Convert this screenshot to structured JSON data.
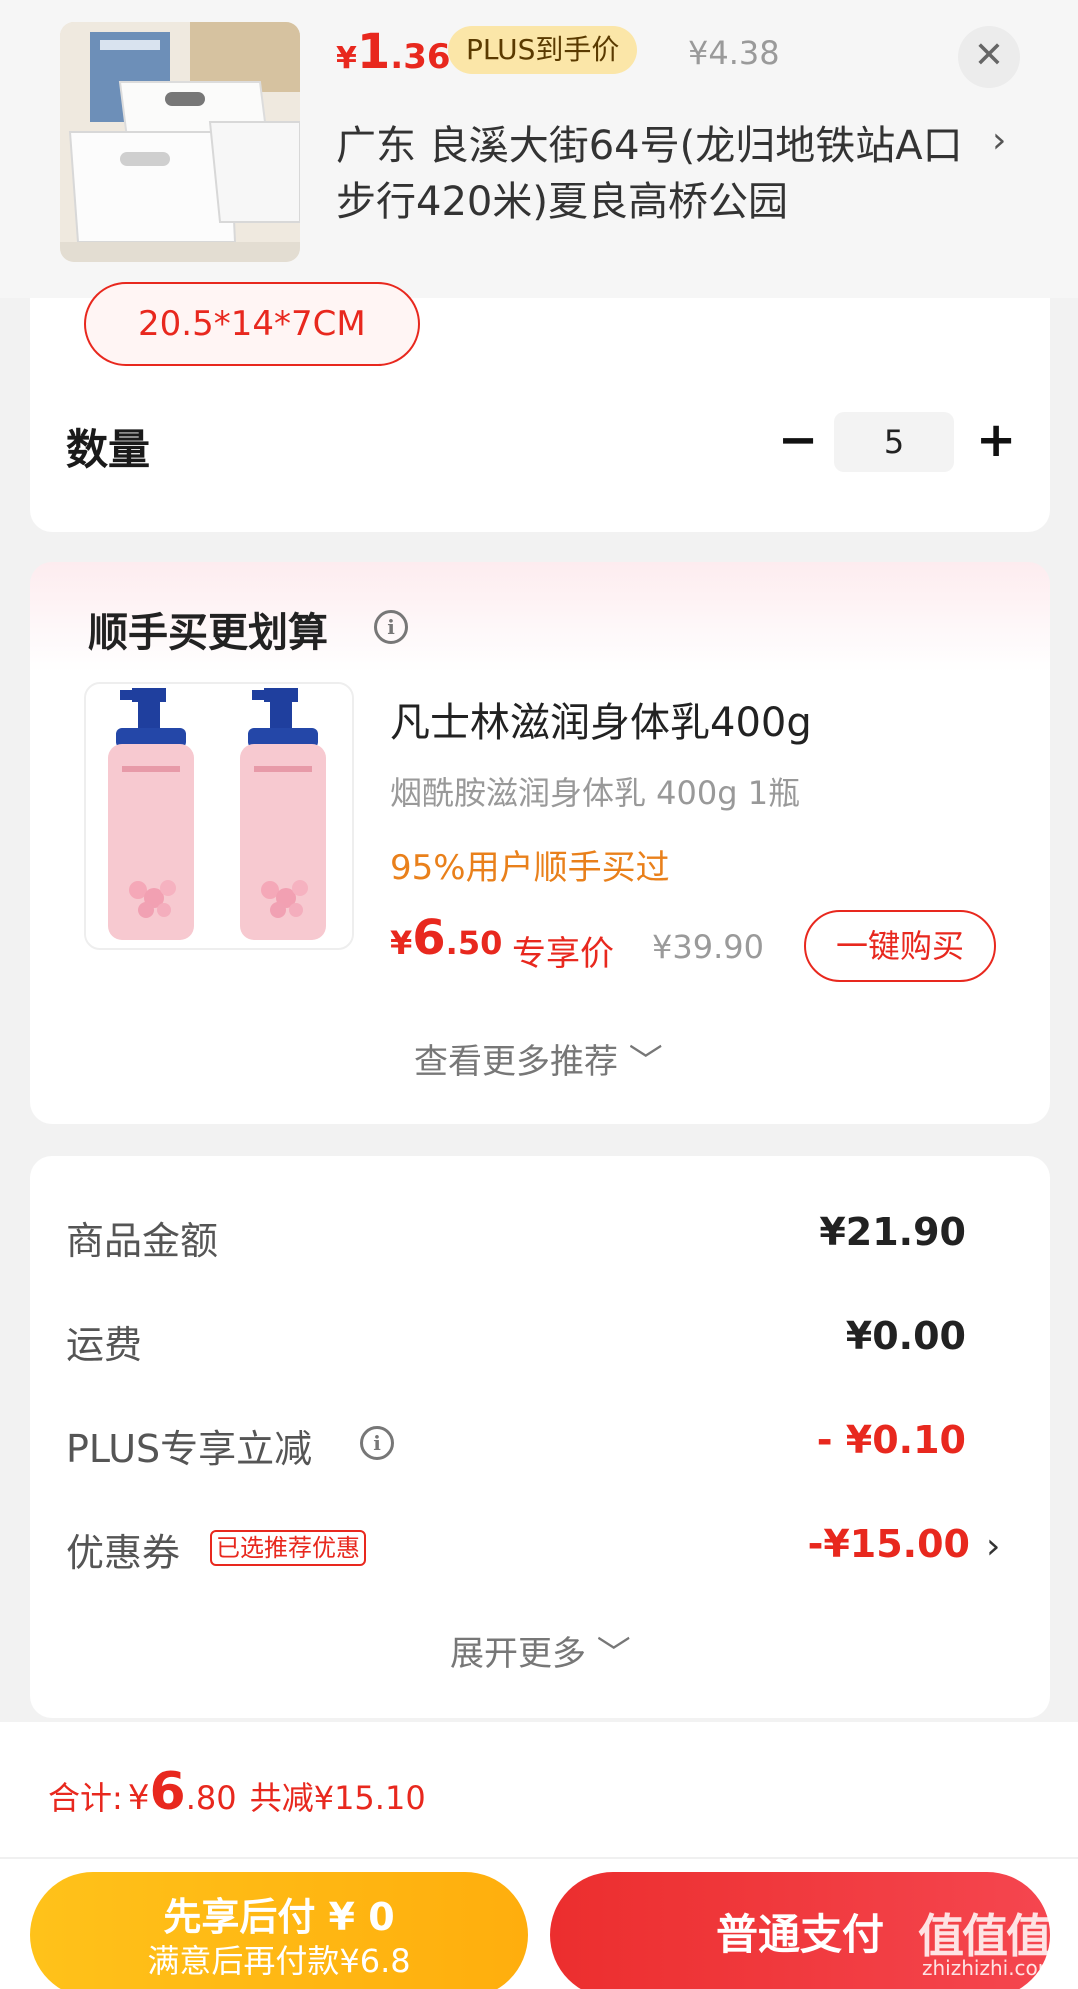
{
  "header": {
    "price_symbol": "¥",
    "price_int": "1",
    "price_dec": ".36",
    "plus_badge": "PLUS到手价",
    "original_price": "¥4.38",
    "close_icon": "close-icon",
    "address": "广东  良溪大街64号(龙归地铁站A口步行420米)夏良高桥公园",
    "address_chevron": "›"
  },
  "spec": {
    "selected_size": "20.5*14*7CM"
  },
  "quantity": {
    "label": "数量",
    "minus": "−",
    "value": "5",
    "plus": "+"
  },
  "recommend": {
    "title": "顺手买更划算",
    "info_icon": "i",
    "product_name": "凡士林滋润身体乳400g",
    "product_sub": "烟酰胺滋润身体乳 400g 1瓶",
    "product_note": "95%用户顺手买过",
    "price_symbol": "¥",
    "price_int": "6",
    "price_dec": ".50",
    "exclusive_label": "专享价",
    "original_price": "¥39.90",
    "buy_button": "一键购买",
    "more_link": "查看更多推荐 ﹀"
  },
  "summary": {
    "rows": [
      {
        "label": "商品金额",
        "value": "¥21.90"
      },
      {
        "label": "运费",
        "value": "¥0.00"
      },
      {
        "label": "PLUS专享立减",
        "value": "- ¥0.10"
      },
      {
        "label": "优惠券",
        "value": "-¥15.00"
      }
    ],
    "coupon_tag": "已选推荐优惠",
    "coupon_chevron": "›",
    "expand_link": "展开更多 ﹀"
  },
  "footer": {
    "total_label": "合计:",
    "total_symbol": "¥",
    "total_int": "6",
    "total_dec": ".80",
    "total_saved": "共减¥15.10",
    "pay_later_title": "先享后付 ¥ 0",
    "pay_later_sub": "满意后再付款¥6.8",
    "pay_button": "普通支付",
    "watermark": "值值值",
    "watermark_sub": "zhizhizhi.com"
  },
  "colors": {
    "accent_red": "#e8281e",
    "orange": "#e9801b",
    "gold": "#ffc21a"
  }
}
